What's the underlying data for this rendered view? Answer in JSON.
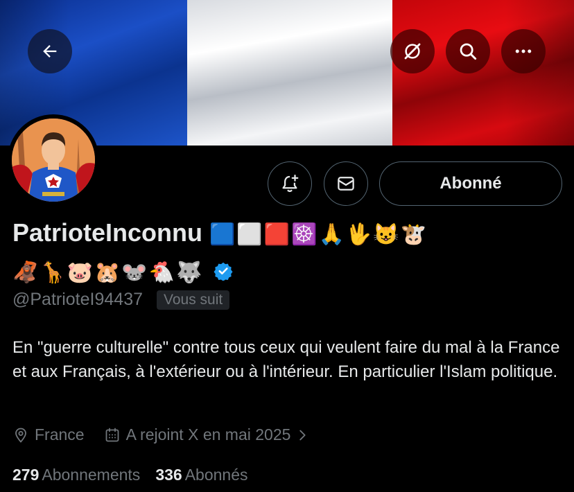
{
  "header": {
    "back_icon": "arrow-left-icon",
    "grok_icon": "grok-icon",
    "search_icon": "search-icon",
    "more_icon": "more-icon"
  },
  "profile": {
    "display_name": "PatrioteInconnu",
    "name_emojis_line1": "🟦⬜🟥☸️🙏🖖😺🐮",
    "name_emojis_line2": "🦧🦒🐷🐹🐭🐔🐺",
    "handle": "@PatrioteI94437",
    "follows_you": "Vous suit",
    "follow_button": "Abonné",
    "bio": "En \"guerre culturelle\" contre tous ceux qui veulent faire du mal à la France et aux Français, à l'extérieur ou à l'intérieur. En particulier l'Islam politique.",
    "location": "France",
    "joined": "A rejoint X en mai 2025",
    "following_count": "279",
    "following_label": "Abonnements",
    "followers_count": "336",
    "followers_label": "Abonnés"
  },
  "colors": {
    "background": "#000000",
    "text_primary": "#e7e9ea",
    "text_secondary": "#71767b",
    "verified_blue": "#1d9bf0",
    "border": "#536471"
  }
}
